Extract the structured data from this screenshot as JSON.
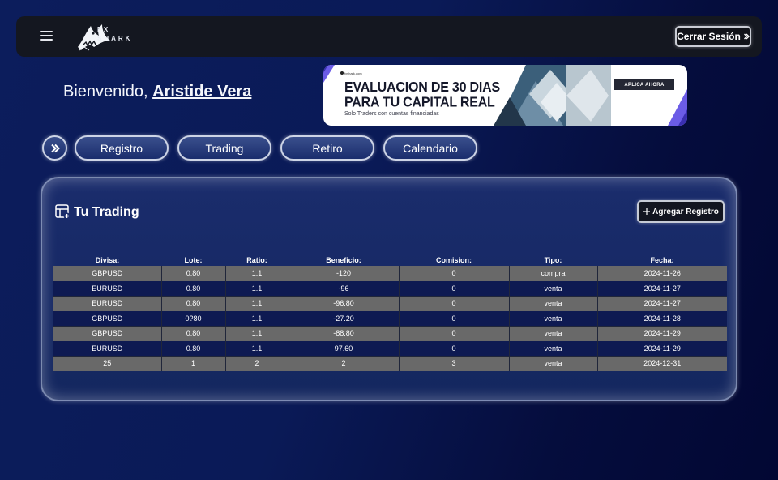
{
  "header": {
    "brand_line1": "FX",
    "brand_line2": "SHARK",
    "logout_label": "Cerrar Sesión"
  },
  "welcome": {
    "greeting": "Bienvenido,",
    "user_name": "Aristide Vera"
  },
  "banner": {
    "source": "fxshark.com",
    "title_line1": "EVALUACION DE 30 DIAS",
    "title_line2": "PARA TU CAPITAL REAL",
    "subtitle": "Solo Traders con cuentas financiadas",
    "cta": "APLICA AHORA",
    "accent_color": "#6b5ce7"
  },
  "nav": {
    "toggle_icon": "chevron-right-icon",
    "items": [
      {
        "label": "Registro"
      },
      {
        "label": "Trading"
      },
      {
        "label": "Retiro"
      },
      {
        "label": "Calendario"
      }
    ]
  },
  "panel": {
    "title": "Tu Trading",
    "add_label": "Agregar Registro",
    "columns": [
      "Divisa:",
      "Lote:",
      "Ratio:",
      "Beneficio:",
      "Comision:",
      "Tipo:",
      "Fecha:"
    ],
    "rows": [
      [
        "GBPUSD",
        "0.80",
        "1.1",
        "-120",
        "0",
        "compra",
        "2024-11-26"
      ],
      [
        "EURUSD",
        "0.80",
        "1.1",
        "-96",
        "0",
        "venta",
        "2024-11-27"
      ],
      [
        "EURUSD",
        "0.80",
        "1.1",
        "-96.80",
        "0",
        "venta",
        "2024-11-27"
      ],
      [
        "GBPUSD",
        "0?80",
        "1.1",
        "-27.20",
        "0",
        "venta",
        "2024-11-28"
      ],
      [
        "GBPUSD",
        "0.80",
        "1.1",
        "-88.80",
        "0",
        "venta",
        "2024-11-29"
      ],
      [
        "EURUSD",
        "0.80",
        "1.1",
        "97.60",
        "0",
        "venta",
        "2024-11-29"
      ],
      [
        "25",
        "1",
        "2",
        "2",
        "3",
        "venta",
        "2024-12-31"
      ]
    ]
  },
  "colors": {
    "row_alt": "#696969",
    "row_base": "#0e1a52",
    "topbar": "#141720"
  }
}
